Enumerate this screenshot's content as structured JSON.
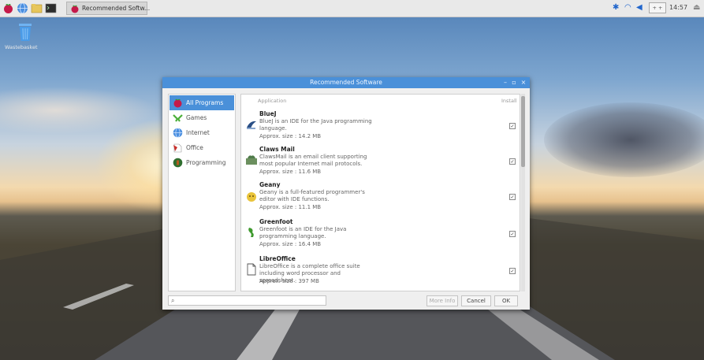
{
  "taskbar": {
    "task_label": "Recommended Softw...",
    "clock": "14:57",
    "volume_label": "+ +"
  },
  "desktop": {
    "trash_label": "Wastebasket"
  },
  "dialog": {
    "title": "Recommended Software",
    "controls": {
      "minimize": "–",
      "maximize": "▫",
      "close": "×"
    },
    "categories": [
      {
        "label": "All Programs",
        "selected": true,
        "icon": "raspberry-icon"
      },
      {
        "label": "Games",
        "selected": false,
        "icon": "games-icon"
      },
      {
        "label": "Internet",
        "selected": false,
        "icon": "globe-icon"
      },
      {
        "label": "Office",
        "selected": false,
        "icon": "office-icon"
      },
      {
        "label": "Programming",
        "selected": false,
        "icon": "programming-icon"
      }
    ],
    "list_header": {
      "application": "Application",
      "install": "Install"
    },
    "apps": [
      {
        "name": "BlueJ",
        "description": "BlueJ is an IDE for the Java programming language.",
        "size": "Approx. size : 14.2 MB",
        "installed": true,
        "icon": "bluej-icon"
      },
      {
        "name": "Claws Mail",
        "description": "ClawsMail is an email client supporting most popular Internet mail protocols.",
        "size": "Approx. size : 11.6 MB",
        "installed": true,
        "icon": "claws-mail-icon"
      },
      {
        "name": "Geany",
        "description": "Geany is a full-featured programmer's editor with IDE functions.",
        "size": "Approx. size : 11.1 MB",
        "installed": true,
        "icon": "geany-icon"
      },
      {
        "name": "Greenfoot",
        "description": "Greenfoot is an IDE for the Java programming language.",
        "size": "Approx. size : 16.4 MB",
        "installed": true,
        "icon": "greenfoot-icon"
      },
      {
        "name": "LibreOffice",
        "description": "LibreOffice is a complete office suite including word processor and spreadsheet.",
        "size": "Approx. size : 397 MB",
        "installed": true,
        "icon": "libreoffice-icon"
      }
    ],
    "search": {
      "value": ""
    },
    "buttons": {
      "more_info": "More Info",
      "cancel": "Cancel",
      "ok": "OK"
    },
    "checkbox_mark": "✓"
  },
  "colors": {
    "accent": "#4a90d9",
    "taskbar": "#e9e9e9",
    "dialog_bg": "#efefef"
  }
}
